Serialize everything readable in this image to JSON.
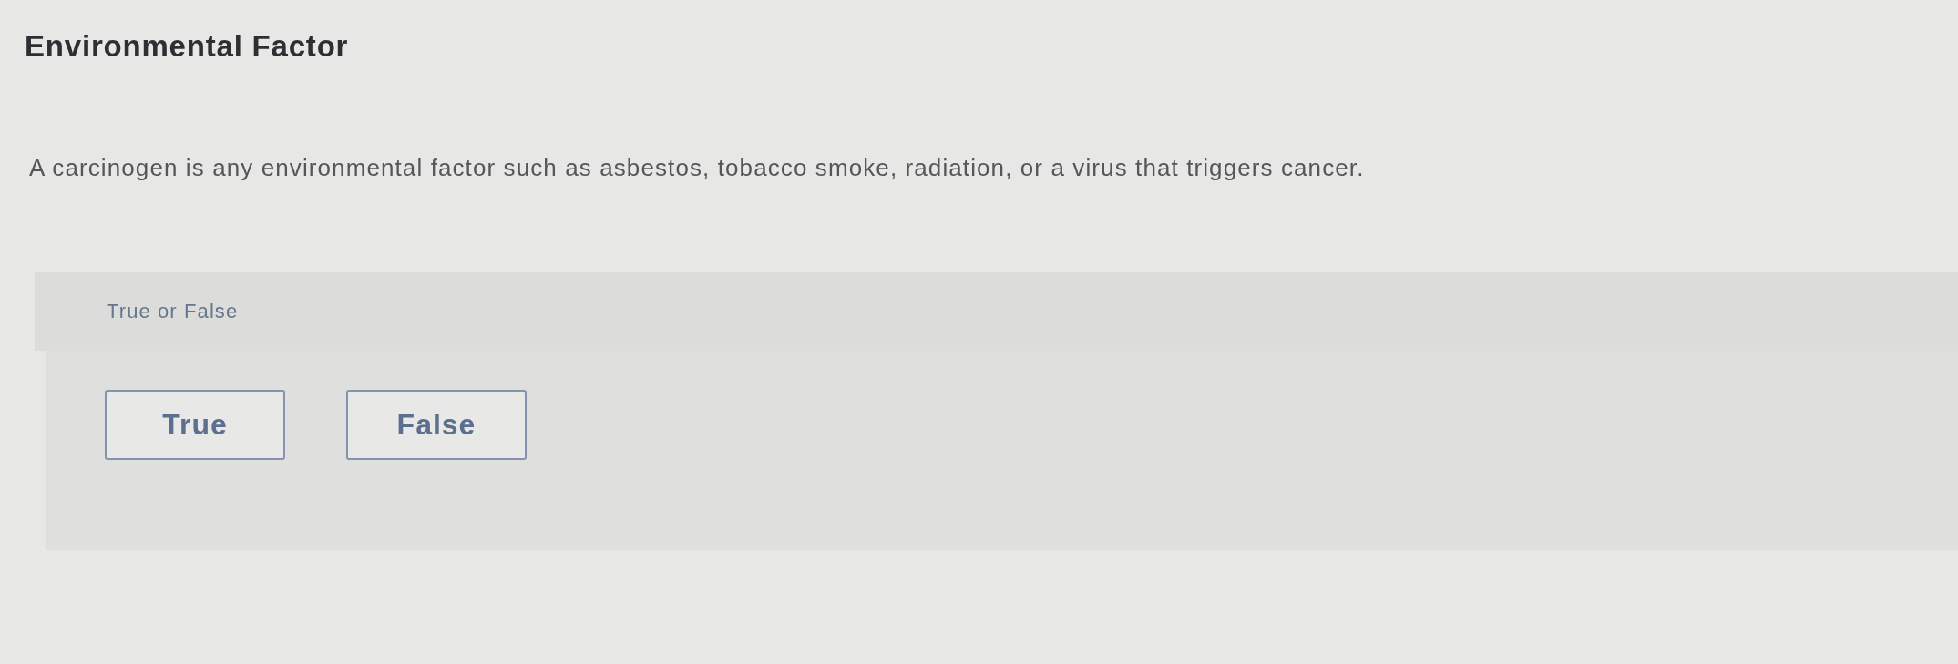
{
  "title": "Environmental Factor",
  "question": {
    "text": "A carcinogen is any environmental factor such as asbestos, tobacco smoke, radiation, or a virus that triggers cancer."
  },
  "answer_area": {
    "prompt": "True or False",
    "options": [
      {
        "label": "True",
        "selected": false
      },
      {
        "label": "False",
        "selected": false
      }
    ]
  }
}
